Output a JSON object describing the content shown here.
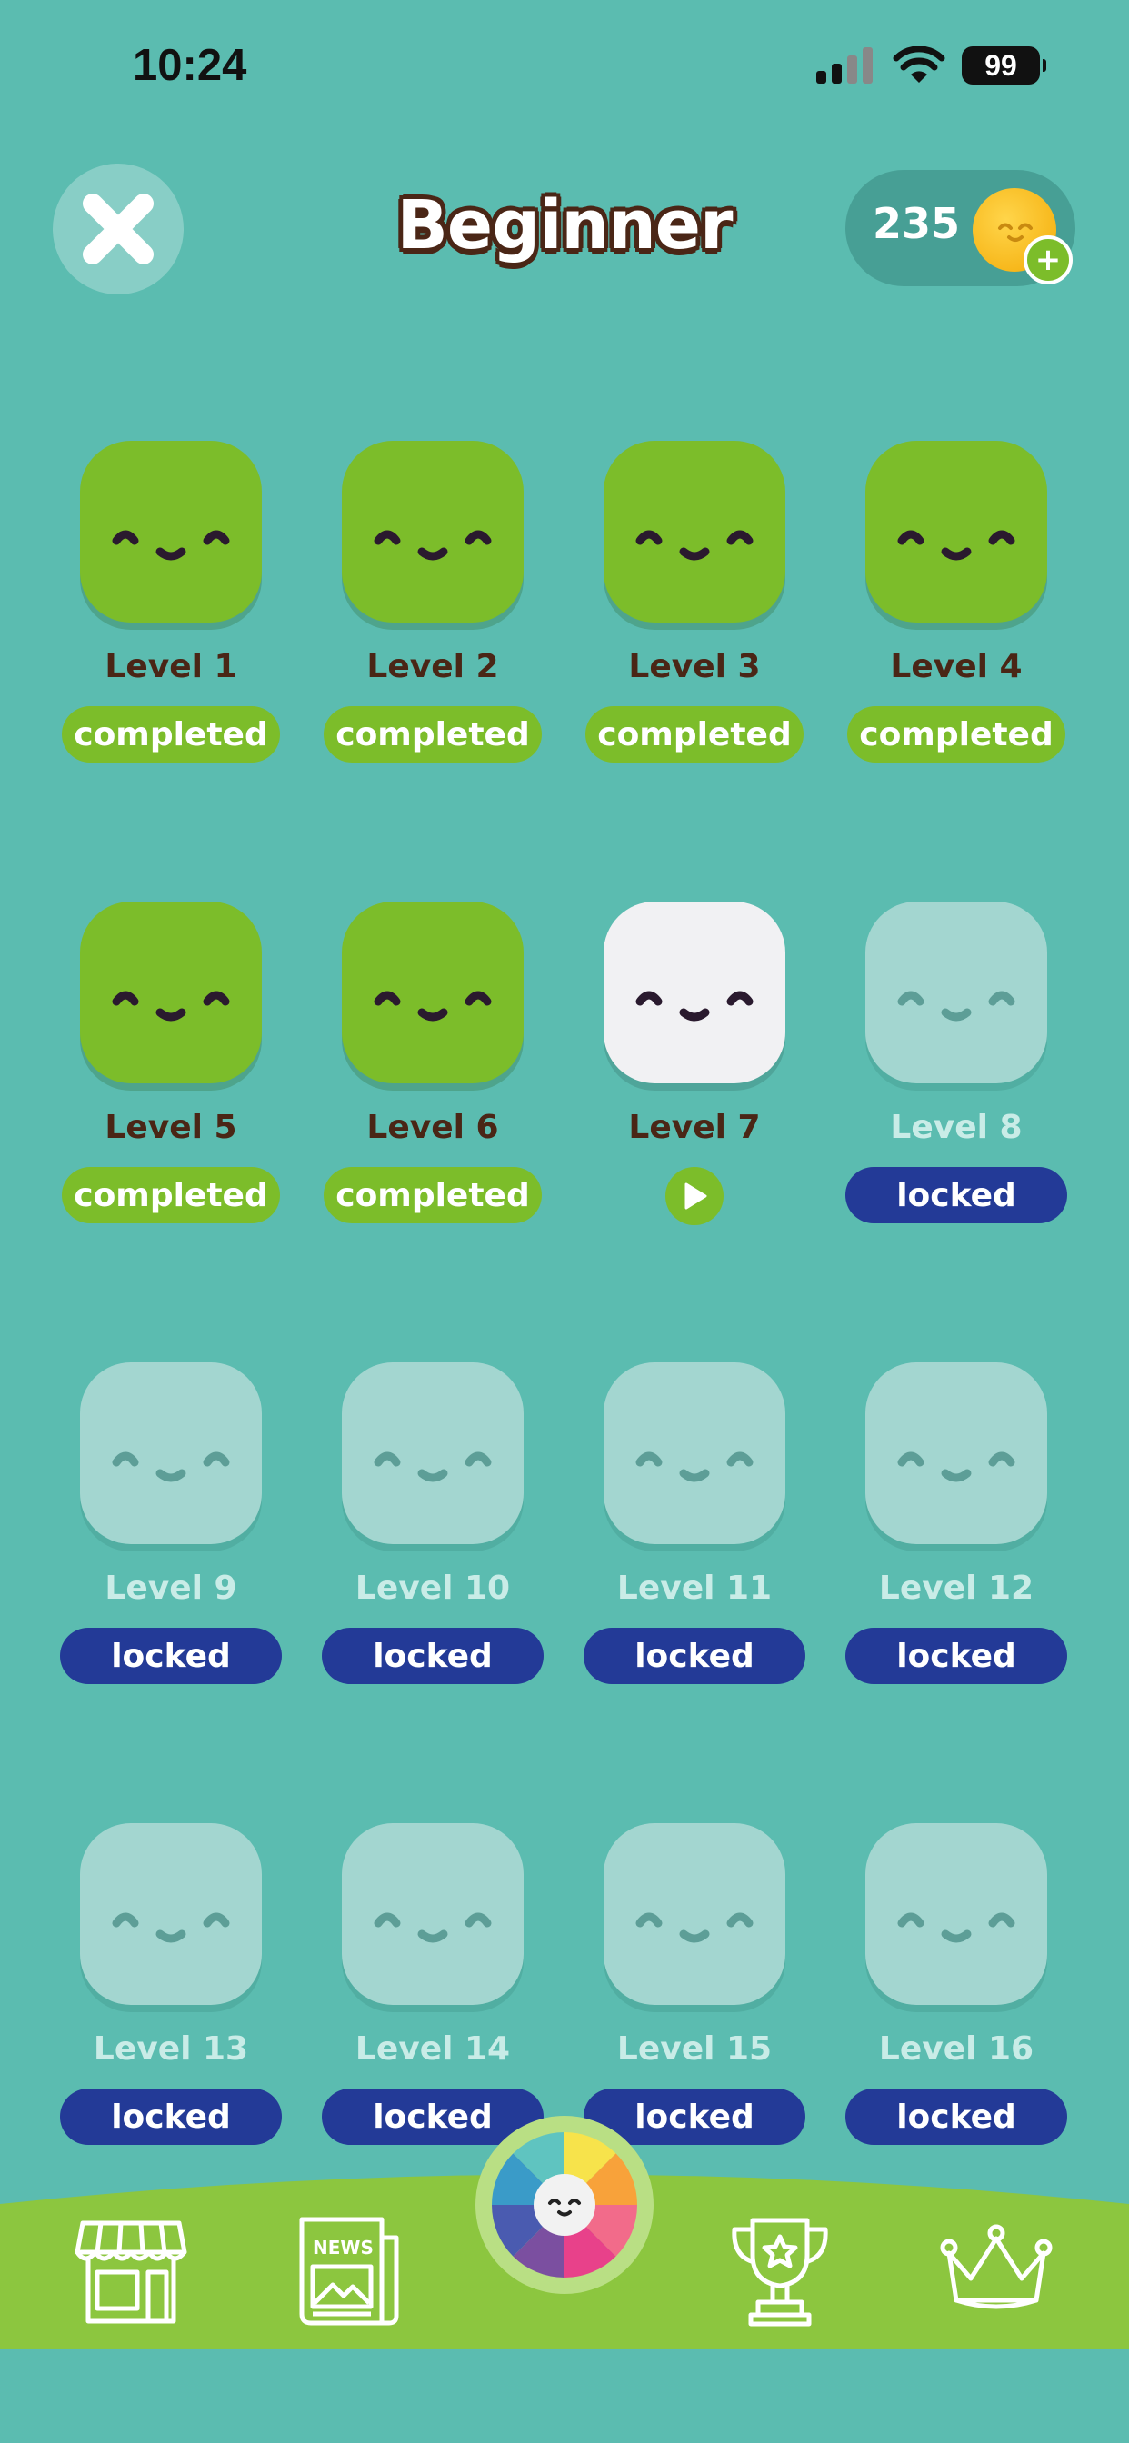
{
  "status_bar": {
    "time": "10:24",
    "battery": "99"
  },
  "header": {
    "title": "Beginner",
    "coins": "235"
  },
  "levels": [
    {
      "label": "Level 1",
      "state": "completed",
      "badge": "completed"
    },
    {
      "label": "Level 2",
      "state": "completed",
      "badge": "completed"
    },
    {
      "label": "Level 3",
      "state": "completed",
      "badge": "completed"
    },
    {
      "label": "Level 4",
      "state": "completed",
      "badge": "completed"
    },
    {
      "label": "Level 5",
      "state": "completed",
      "badge": "completed"
    },
    {
      "label": "Level 6",
      "state": "completed",
      "badge": "completed"
    },
    {
      "label": "Level 7",
      "state": "current",
      "badge": ""
    },
    {
      "label": "Level 8",
      "state": "locked",
      "badge": "locked"
    },
    {
      "label": "Level 9",
      "state": "locked",
      "badge": "locked"
    },
    {
      "label": "Level 10",
      "state": "locked",
      "badge": "locked"
    },
    {
      "label": "Level 11",
      "state": "locked",
      "badge": "locked"
    },
    {
      "label": "Level 12",
      "state": "locked",
      "badge": "locked"
    },
    {
      "label": "Level 13",
      "state": "locked",
      "badge": "locked"
    },
    {
      "label": "Level 14",
      "state": "locked",
      "badge": "locked"
    },
    {
      "label": "Level 15",
      "state": "locked",
      "badge": "locked"
    },
    {
      "label": "Level 16",
      "state": "locked",
      "badge": "locked"
    }
  ],
  "bottom_nav": {
    "news_label": "NEWS",
    "items": [
      "shop-icon",
      "news-icon",
      "color-wheel-icon",
      "trophy-icon",
      "crown-icon"
    ]
  },
  "colors": {
    "background": "#5bbcb0",
    "completed": "#7cbd2a",
    "locked_badge": "#233a97",
    "locked_tile": "#a3d6d0",
    "title_outline": "#4a2616",
    "nav_green": "#8cc63f"
  }
}
